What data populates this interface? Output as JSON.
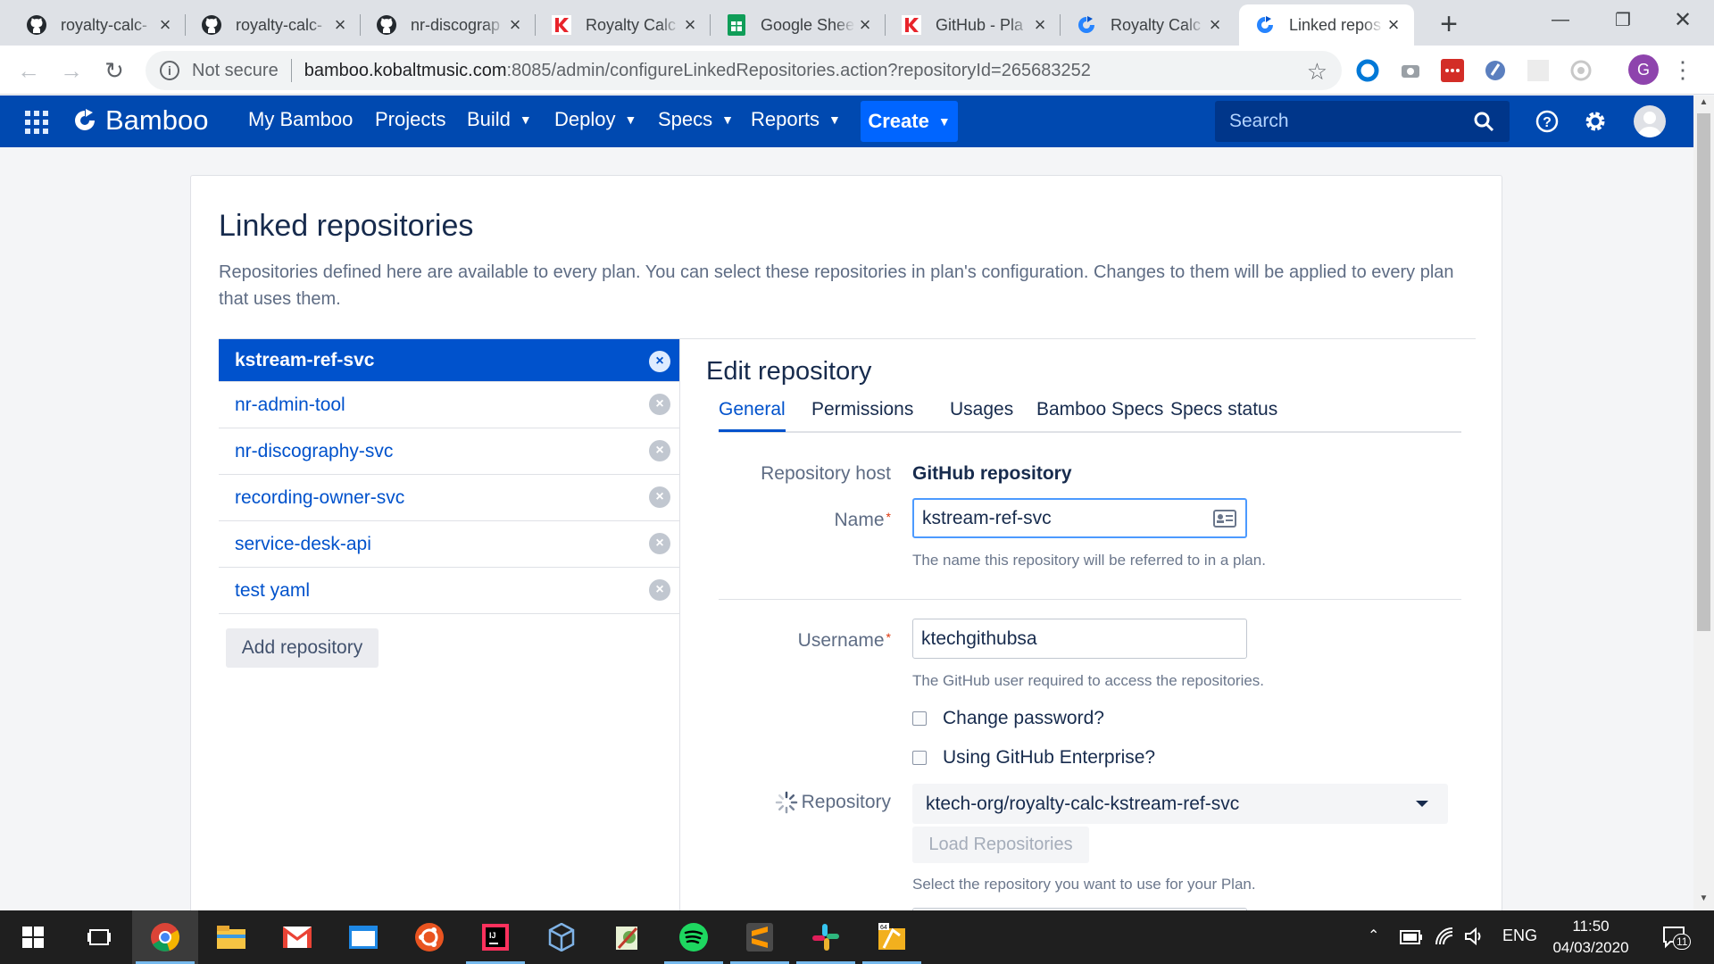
{
  "browser": {
    "tabs": [
      {
        "title": "royalty-calc-",
        "favicon": "github-icon"
      },
      {
        "title": "royalty-calc-",
        "favicon": "github-icon"
      },
      {
        "title": "nr-discograp",
        "favicon": "github-icon"
      },
      {
        "title": "Royalty Calc",
        "favicon": "kobalt-icon"
      },
      {
        "title": "Google Shee",
        "favicon": "google-sheets-icon"
      },
      {
        "title": "GitHub - Pla",
        "favicon": "kobalt-icon"
      },
      {
        "title": "Royalty Calc",
        "favicon": "bamboo-icon"
      },
      {
        "title": "Linked repos",
        "favicon": "bamboo-icon",
        "active": true
      }
    ],
    "security_label": "Not secure",
    "url_host": "bamboo.kobaltmusic.com",
    "url_path": ":8085/admin/configureLinkedRepositories.action?repositoryId=265683252",
    "profile_initial": "G"
  },
  "bamboo": {
    "brand": "Bamboo",
    "nav": {
      "my_bamboo": "My Bamboo",
      "projects": "Projects",
      "build": "Build",
      "deploy": "Deploy",
      "specs": "Specs",
      "reports": "Reports"
    },
    "create_label": "Create",
    "search_placeholder": "Search",
    "colors": {
      "header": "#0049b0",
      "create": "#0065ff",
      "link": "#0052cc"
    }
  },
  "page": {
    "title": "Linked repositories",
    "description": "Repositories defined here are available to every plan. You can select these repositories in plan's configuration. Changes to them will be applied to every plan that uses them.",
    "repositories": [
      {
        "name": "kstream-ref-svc",
        "selected": true
      },
      {
        "name": "nr-admin-tool"
      },
      {
        "name": "nr-discography-svc"
      },
      {
        "name": "recording-owner-svc"
      },
      {
        "name": "service-desk-api"
      },
      {
        "name": "test yaml"
      }
    ],
    "add_repository_label": "Add repository"
  },
  "edit": {
    "title": "Edit repository",
    "tabs": [
      "General",
      "Permissions",
      "Usages",
      "Bamboo Specs",
      "Specs status"
    ],
    "active_tab": "General",
    "repository_host_label": "Repository host",
    "repository_host_value": "GitHub repository",
    "name_label": "Name",
    "name_value": "kstream-ref-svc",
    "name_help": "The name this repository will be referred to in a plan.",
    "username_label": "Username",
    "username_value": "ktechgithubsa",
    "username_help": "The GitHub user required to access the repositories.",
    "change_password_label": "Change password?",
    "enterprise_label": "Using GitHub Enterprise?",
    "repository_label": "Repository",
    "repository_value": "ktech-org/royalty-calc-kstream-ref-svc",
    "load_repositories_label": "Load Repositories",
    "repository_help": "Select the repository you want to use for your Plan."
  },
  "taskbar": {
    "language": "ENG",
    "time": "11:50",
    "date": "04/03/2020",
    "notifications": "11"
  }
}
